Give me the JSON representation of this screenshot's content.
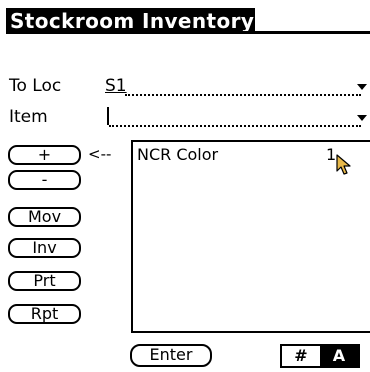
{
  "header": {
    "title": "Stockroom Inventory"
  },
  "form": {
    "to_loc_label": "To Loc",
    "to_loc_value": "S1",
    "item_label": "Item",
    "item_value": ""
  },
  "side_buttons": {
    "plus": "+",
    "minus": "-",
    "move": "Mov",
    "inventory": "Inv",
    "print": "Prt",
    "report": "Rpt"
  },
  "indicator": "<--",
  "list": {
    "items": [
      {
        "name": "NCR Color",
        "qty": "1"
      }
    ]
  },
  "footer": {
    "enter_label": "Enter",
    "numeric_mode": "#",
    "alpha_mode": "A"
  }
}
